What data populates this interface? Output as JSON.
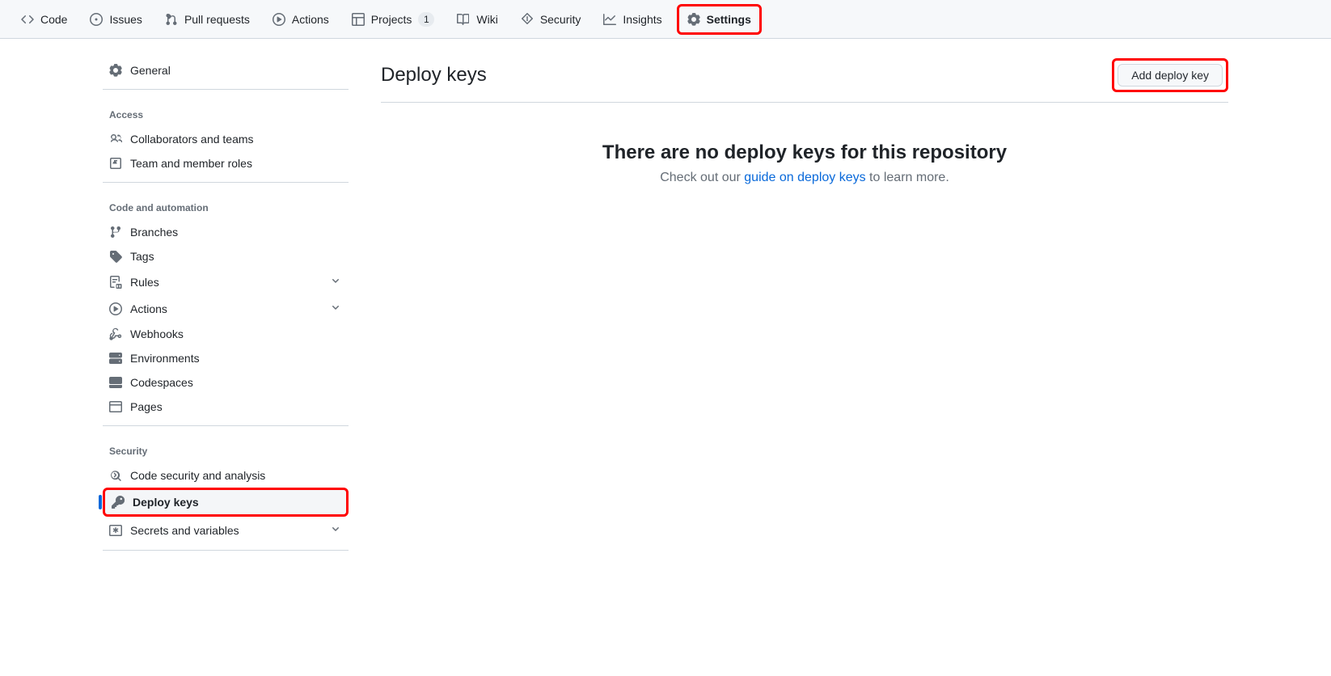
{
  "topnav": {
    "items": [
      {
        "label": "Code"
      },
      {
        "label": "Issues"
      },
      {
        "label": "Pull requests"
      },
      {
        "label": "Actions"
      },
      {
        "label": "Projects",
        "count": "1"
      },
      {
        "label": "Wiki"
      },
      {
        "label": "Security"
      },
      {
        "label": "Insights"
      },
      {
        "label": "Settings"
      }
    ]
  },
  "sidebar": {
    "general": "General",
    "headings": {
      "access": "Access",
      "code": "Code and automation",
      "security": "Security"
    },
    "access": [
      {
        "label": "Collaborators and teams"
      },
      {
        "label": "Team and member roles"
      }
    ],
    "code": [
      {
        "label": "Branches"
      },
      {
        "label": "Tags"
      },
      {
        "label": "Rules"
      },
      {
        "label": "Actions"
      },
      {
        "label": "Webhooks"
      },
      {
        "label": "Environments"
      },
      {
        "label": "Codespaces"
      },
      {
        "label": "Pages"
      }
    ],
    "security": [
      {
        "label": "Code security and analysis"
      },
      {
        "label": "Deploy keys"
      },
      {
        "label": "Secrets and variables"
      }
    ]
  },
  "main": {
    "title": "Deploy keys",
    "add_button": "Add deploy key",
    "blank_heading": "There are no deploy keys for this repository",
    "blank_prefix": "Check out our ",
    "blank_link": "guide on deploy keys",
    "blank_suffix": " to learn more."
  }
}
